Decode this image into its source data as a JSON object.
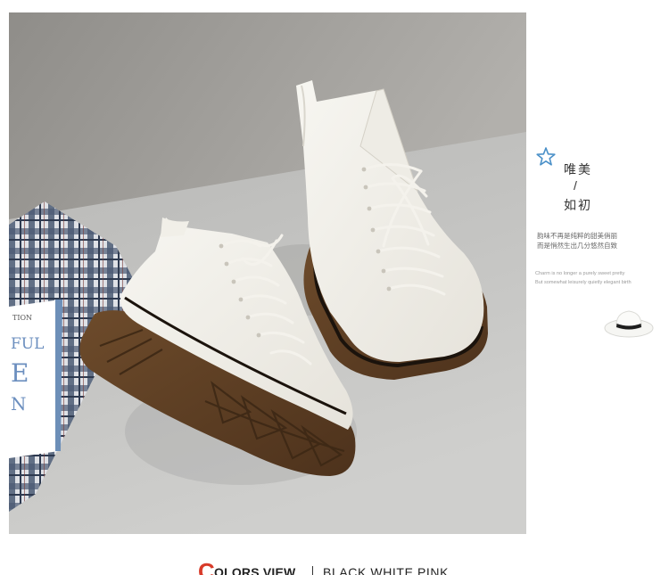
{
  "product_photo": {
    "alt": "",
    "book_cover_text": [
      "TION",
      "FUL",
      "E",
      "N"
    ]
  },
  "side_caption": {
    "line1": "唯美",
    "slash": "/",
    "line2": "如初",
    "cn_lines": [
      "韵味不再是纯粹的甜美俏丽",
      "而是悄然生出几分悠然自致"
    ],
    "en_lines": [
      "Charm is no longer a purely sweet pretty",
      "But somewhat leisurely quietly elegant birth"
    ]
  },
  "colors": {
    "first_letter": "C",
    "title": "OLORS VIEW",
    "list": "BLACK  WHITE  PINK",
    "accent": "#d83b2a"
  },
  "icons": [
    "star-icon",
    "hat-icon"
  ]
}
